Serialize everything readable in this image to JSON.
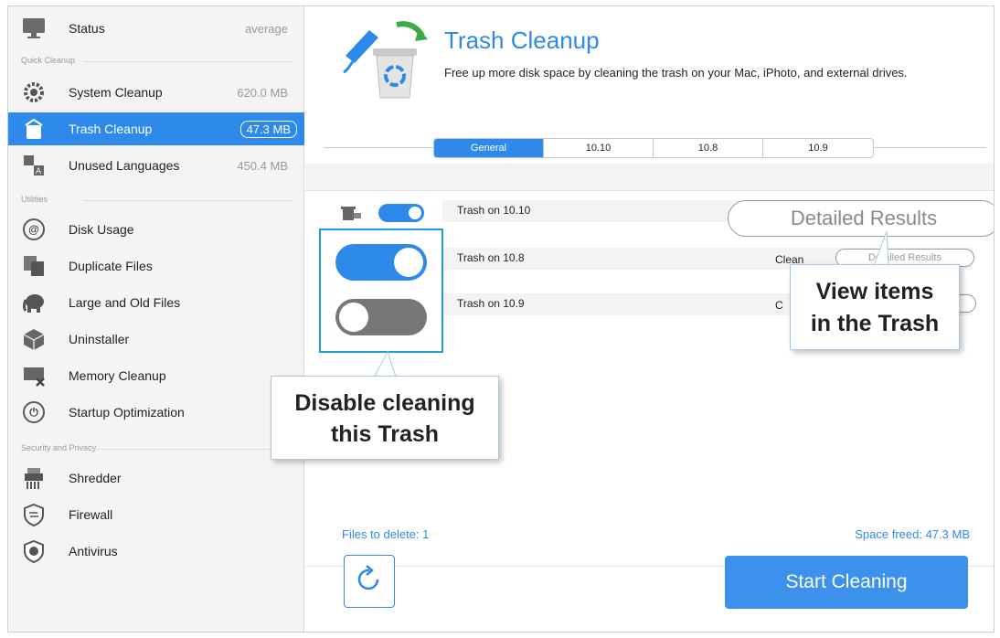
{
  "sidebar": {
    "status": {
      "label": "Status",
      "value": "average"
    },
    "sections": {
      "quick_cleanup": "Quick Cleanup",
      "utilities": "Utilities",
      "security": "Security and Privacy"
    },
    "quick": [
      {
        "label": "System Cleanup",
        "value": "620.0 MB",
        "icon": "gear-icon"
      },
      {
        "label": "Trash Cleanup",
        "value": "47.3 MB",
        "icon": "trash-icon"
      },
      {
        "label": "Unused Languages",
        "value": "450.4 MB",
        "icon": "language-icon"
      }
    ],
    "utilities": [
      {
        "label": "Disk Usage",
        "icon": "disk-icon"
      },
      {
        "label": "Duplicate Files",
        "icon": "duplicate-icon"
      },
      {
        "label": "Large and Old Files",
        "icon": "elephant-icon"
      },
      {
        "label": "Uninstaller",
        "icon": "box-icon"
      },
      {
        "label": "Memory Cleanup",
        "icon": "memory-icon"
      },
      {
        "label": "Startup Optimization",
        "icon": "power-icon"
      }
    ],
    "security": [
      {
        "label": "Shredder",
        "icon": "shredder-icon"
      },
      {
        "label": "Firewall",
        "icon": "firewall-icon"
      },
      {
        "label": "Antivirus",
        "icon": "antivirus-icon"
      }
    ]
  },
  "main": {
    "title": "Trash Cleanup",
    "description": "Free up more disk space by cleaning the trash on your Mac, iPhoto, and external drives.",
    "tabs": [
      "General",
      "10.10",
      "10.8",
      "10.9"
    ],
    "rows": [
      {
        "label": "Trash on 10.10",
        "enabled": true
      },
      {
        "label": "Trash on 10.8",
        "enabled": true,
        "clean": "Clean",
        "button": "Detailed Results"
      },
      {
        "label": "Trash on 10.9",
        "enabled": false
      }
    ],
    "detailed_results": "Detailed Results",
    "files_to_delete": "Files to delete: 1",
    "space_freed": "Space freed: 47.3 MB",
    "start_button": "Start Cleaning"
  },
  "callouts": {
    "view_items_1": "View items",
    "view_items_2": "in the Trash",
    "disable_1": "Disable cleaning",
    "disable_2": "this Trash"
  },
  "colors": {
    "accent": "#2d89ea",
    "callout_border": "#1a9ee0"
  }
}
